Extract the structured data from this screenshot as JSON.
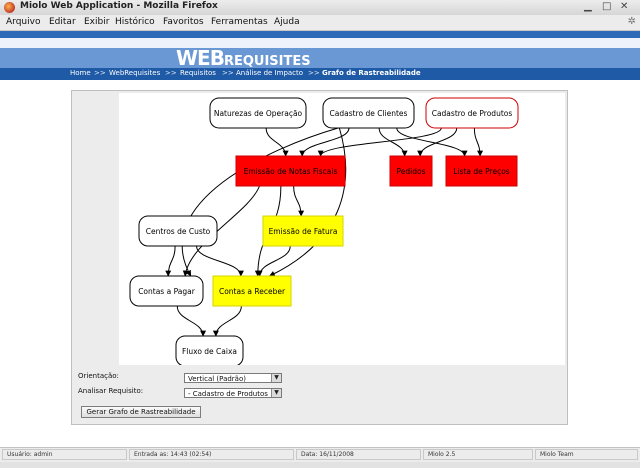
{
  "window": {
    "title": "Miolo Web Application - Mozilla Firefox"
  },
  "menu": [
    "Arquivo",
    "Editar",
    "Exibir",
    "Histórico",
    "Favoritos",
    "Ferramentas",
    "Ajuda"
  ],
  "logo": {
    "prefix": "WEB",
    "suffix": "REQUISITES"
  },
  "breadcrumb": [
    "Home",
    "WebRequisites",
    "Requisitos",
    "Análise de Impacto",
    "Grafo de Rastreabilidade"
  ],
  "breadcrumb_separator": ">>",
  "graph": {
    "nodes": [
      {
        "id": "naturezas",
        "label": "Naturezas de Operação",
        "style": "rounded",
        "color": "#000000",
        "fill": "#ffffff"
      },
      {
        "id": "clientes",
        "label": "Cadastro de Clientes",
        "style": "rounded",
        "color": "#000000",
        "fill": "#ffffff"
      },
      {
        "id": "produtos",
        "label": "Cadastro de Produtos",
        "style": "rounded",
        "color": "#cc0000",
        "fill": "#ffffff"
      },
      {
        "id": "notas",
        "label": "Emissão de Notas Fiscais",
        "style": "box",
        "color": "#cc0000",
        "fill": "#ff0000"
      },
      {
        "id": "pedidos",
        "label": "Pedidos",
        "style": "box",
        "color": "#cc0000",
        "fill": "#ff0000"
      },
      {
        "id": "precos",
        "label": "Lista de Preços",
        "style": "box",
        "color": "#cc0000",
        "fill": "#ff0000"
      },
      {
        "id": "custo",
        "label": "Centros de Custo",
        "style": "rounded",
        "color": "#000000",
        "fill": "#ffffff"
      },
      {
        "id": "fatura",
        "label": "Emissão de Fatura",
        "style": "box",
        "color": "#d4d400",
        "fill": "#ffff00"
      },
      {
        "id": "pagar",
        "label": "Contas a Pagar",
        "style": "rounded",
        "color": "#000000",
        "fill": "#ffffff"
      },
      {
        "id": "receber",
        "label": "Contas a Receber",
        "style": "box",
        "color": "#d4d400",
        "fill": "#ffff00"
      },
      {
        "id": "caixa",
        "label": "Fluxo de Caixa",
        "style": "rounded",
        "color": "#000000",
        "fill": "#ffffff"
      }
    ],
    "edges": [
      [
        "naturezas",
        "notas"
      ],
      [
        "clientes",
        "notas"
      ],
      [
        "clientes",
        "pedidos"
      ],
      [
        "clientes",
        "precos"
      ],
      [
        "clientes",
        "pagar"
      ],
      [
        "clientes",
        "receber"
      ],
      [
        "produtos",
        "notas"
      ],
      [
        "produtos",
        "pedidos"
      ],
      [
        "produtos",
        "precos"
      ],
      [
        "notas",
        "fatura"
      ],
      [
        "notas",
        "receber"
      ],
      [
        "notas",
        "pagar"
      ],
      [
        "fatura",
        "receber"
      ],
      [
        "custo",
        "pagar"
      ],
      [
        "custo",
        "receber"
      ],
      [
        "pagar",
        "caixa"
      ],
      [
        "receber",
        "caixa"
      ]
    ]
  },
  "form": {
    "orientation_label": "Orientação:",
    "orientation_value": "Vertical (Padrão)",
    "requirement_label": "Analisar Requisito:",
    "requirement_value": "- Cadastro de Produtos",
    "generate_button": "Gerar Grafo de Rastreabilidade"
  },
  "status": {
    "user": "Usuário: admin",
    "login": "Entrada as: 14:43 (02:54)",
    "date": "Data: 16/11/2008",
    "version": "Miolo 2.5",
    "team": "Miolo Team"
  },
  "colors": {
    "header_blue": "#2e6ab8",
    "crumb_blue": "#1e5aa6",
    "node_red": "#ff0000",
    "node_yellow": "#ffff00"
  }
}
